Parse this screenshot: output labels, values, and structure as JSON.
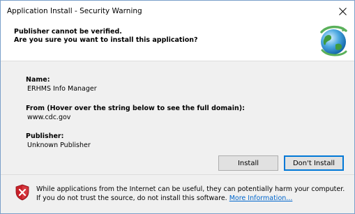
{
  "window": {
    "title": "Application Install - Security Warning"
  },
  "header": {
    "line1": "Publisher cannot be verified.",
    "line2": "Are you sure you want to install this application?"
  },
  "details": {
    "name_label": "Name:",
    "name_value": "ERHMS Info Manager",
    "from_label": "From (Hover over the string below to see the full domain):",
    "from_value": "www.cdc.gov",
    "publisher_label": "Publisher:",
    "publisher_value": "Unknown Publisher"
  },
  "buttons": {
    "install": "Install",
    "dont_install": "Don't Install"
  },
  "footer": {
    "warning_text": "While applications from the Internet can be useful, they can potentially harm your computer. If you do not trust the source, do not install this software. ",
    "more_info": "More Information..."
  },
  "icons": {
    "close": "close-icon",
    "globe": "application-globe-icon",
    "shield": "security-shield-x-icon"
  }
}
